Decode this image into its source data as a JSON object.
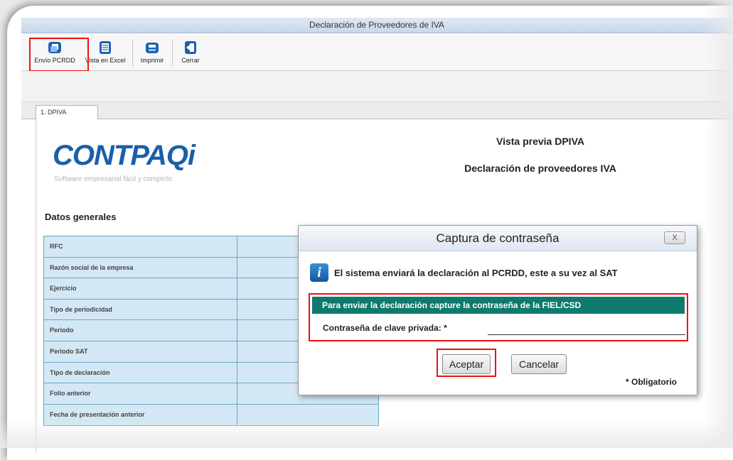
{
  "window": {
    "title": "Declaración de Proveedores de IVA"
  },
  "toolbar": {
    "items": [
      {
        "label": "Envío PCRDD",
        "icon": "send-icon"
      },
      {
        "label": "Vista en Excel",
        "icon": "excel-icon"
      },
      {
        "label": "Imprimir",
        "icon": "printer-icon"
      },
      {
        "label": "Cerrar",
        "icon": "close-door-icon"
      }
    ]
  },
  "tabs": [
    {
      "label": "1. DPIVA"
    }
  ],
  "document": {
    "logo": {
      "brand": "CONTPAQ",
      "brand_suffix": "i",
      "tagline": "Software empresarial fácil y completo"
    },
    "heading": "Vista previa DPIVA",
    "subheading": "Declaración de proveedores IVA",
    "section_title": "Datos generales",
    "fields": [
      {
        "label": "RFC"
      },
      {
        "label": "Razón social de la empresa"
      },
      {
        "label": "Ejercicio"
      },
      {
        "label": "Tipo de periodicidad"
      },
      {
        "label": "Periodo"
      },
      {
        "label": "Periodo SAT"
      },
      {
        "label": "Tipo de declaración"
      },
      {
        "label": "Folio anterior"
      },
      {
        "label": "Fecha de presentación anterior"
      }
    ]
  },
  "dialog": {
    "title": "Captura de contraseña",
    "close_label": "X",
    "info_icon": "i",
    "info_text": "El sistema enviará la declaración al PCRDD, este a su vez al SAT",
    "form_header": "Para enviar la declaración capture la contraseña de la FIEL/CSD",
    "password_label": "Contraseña de clave privada: *",
    "password_value": "",
    "accept_label": "Aceptar",
    "cancel_label": "Cancelar",
    "required_note": "* Obligatorio"
  },
  "colors": {
    "accent": "#1b5fa8",
    "form_header_bg": "#0d7a6d",
    "highlight": "#ee1111",
    "table_bg": "#d3e8f4"
  }
}
